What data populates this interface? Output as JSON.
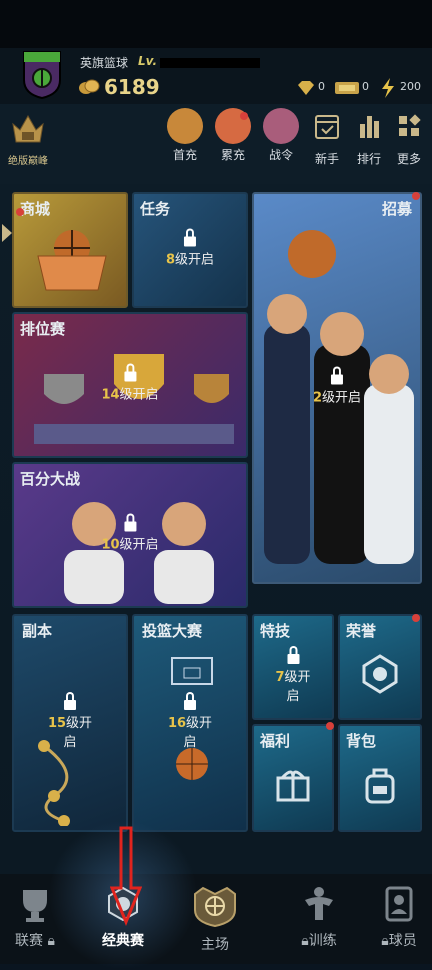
{
  "header": {
    "team_name": "英旗篮球",
    "level_prefix": "Lv.",
    "coins": "6189",
    "gems": "0",
    "tickets": "0",
    "energy": "200"
  },
  "toolbar": {
    "peak_label": "绝版巅峰",
    "items": [
      {
        "label": "首充"
      },
      {
        "label": "累充"
      },
      {
        "label": "战令"
      },
      {
        "label": "新手"
      },
      {
        "label": "排行"
      },
      {
        "label": "更多"
      }
    ]
  },
  "tiles": {
    "shop": {
      "title": "商城"
    },
    "task": {
      "title": "任务",
      "lock_num": "8",
      "lock_text": "级开启"
    },
    "recruit": {
      "title": "招募",
      "lock_num": "2",
      "lock_text": "级开启"
    },
    "ranked": {
      "title": "排位赛",
      "lock_num": "14",
      "lock_text": "级开启"
    },
    "hundred": {
      "title": "百分大战",
      "lock_num": "10",
      "lock_text": "级开启"
    },
    "dungeon": {
      "title": "副本",
      "lock_num": "15",
      "lock_text": "级开启"
    },
    "shooting": {
      "title": "投篮大赛",
      "lock_num": "16",
      "lock_text": "级开启"
    },
    "skills": {
      "title": "特技",
      "lock_num": "7",
      "lock_text": "级开启"
    },
    "honor": {
      "title": "荣誉"
    },
    "welfare": {
      "title": "福利"
    },
    "bag": {
      "title": "背包"
    }
  },
  "nav": [
    {
      "label": "联赛"
    },
    {
      "label": "经典赛"
    },
    {
      "label": "主场"
    },
    {
      "label": "训练"
    },
    {
      "label": "球员"
    }
  ],
  "colors": {
    "accent_gold": "#e7c34a",
    "tile_border": "#1c3a52",
    "badge_red": "#d8403a"
  }
}
